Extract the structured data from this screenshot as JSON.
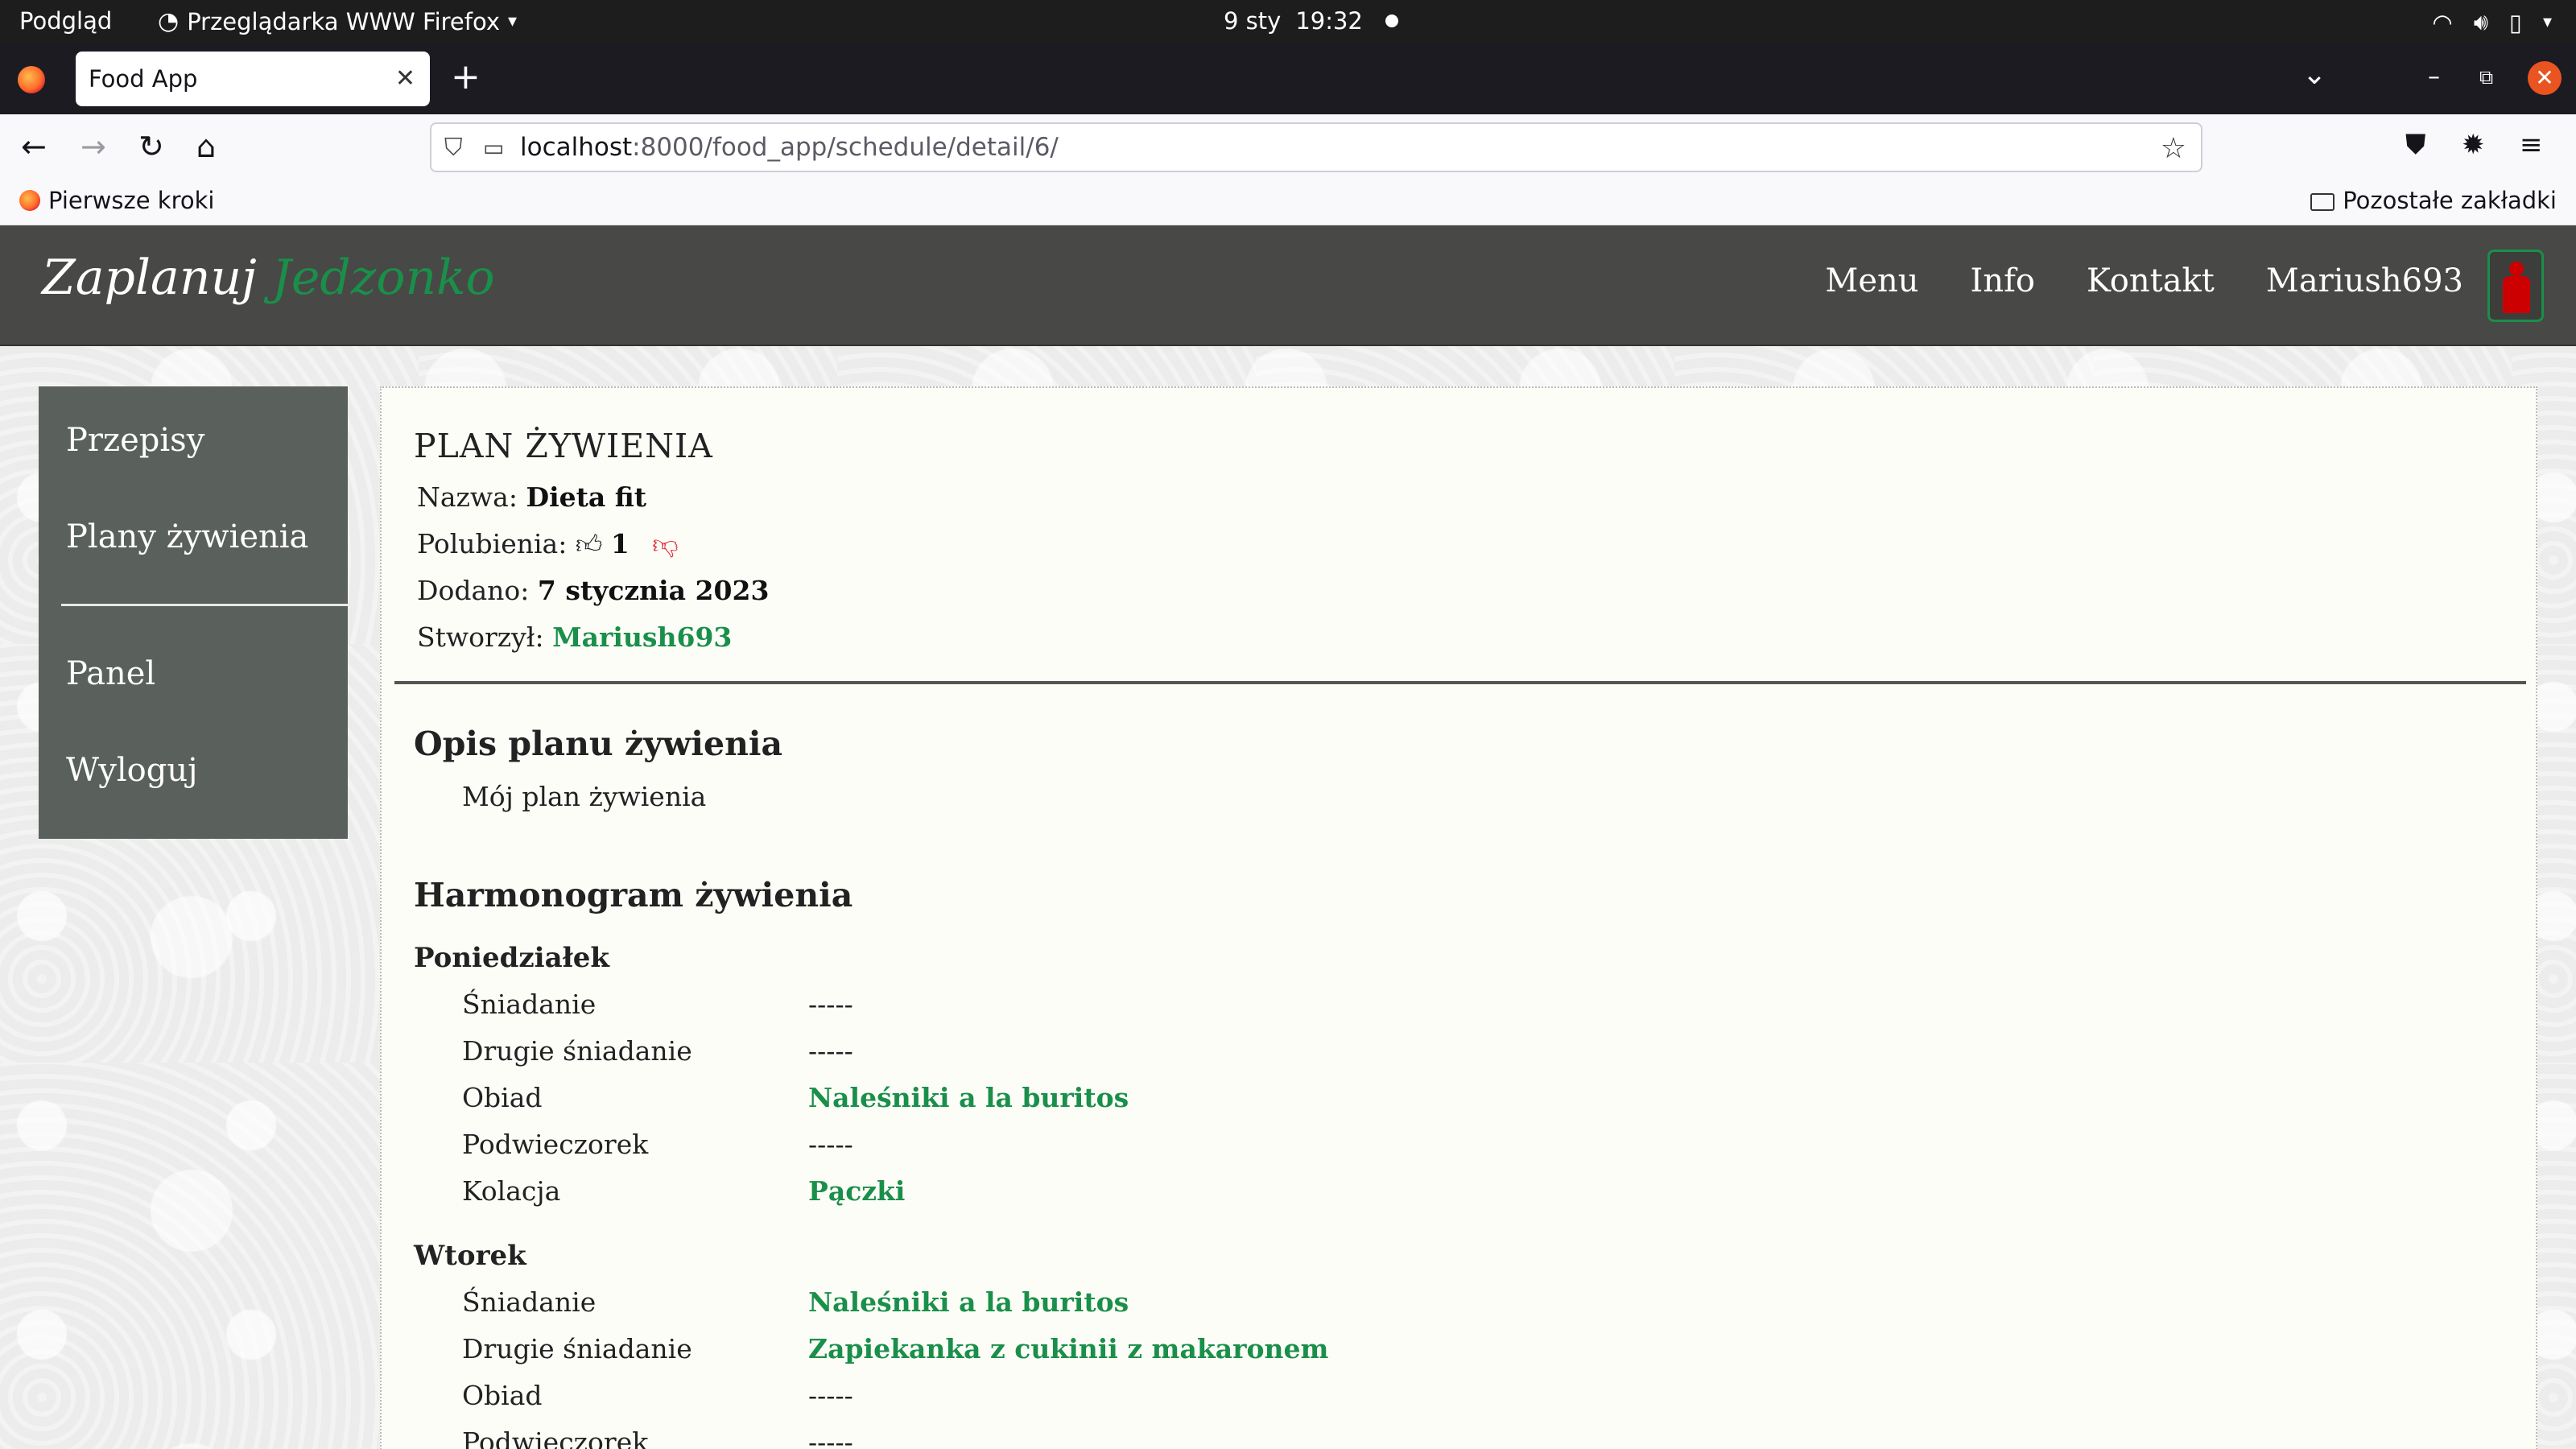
{
  "system_bar": {
    "activities": "Podgląd",
    "app_name": "Przeglądarka WWW Firefox",
    "date": "9 sty",
    "time": "19:32"
  },
  "browser": {
    "tab_title": "Food App",
    "url_host": "localhost",
    "url_path": ":8000/food_app/schedule/detail/6/",
    "bookmark_first": "Pierwsze kroki",
    "bookmark_other": "Pozostałe zakładki"
  },
  "site": {
    "logo_part1": "Zaplanuj",
    "logo_part2": "Jedzonko",
    "nav": [
      "Menu",
      "Info",
      "Kontakt",
      "Mariush693"
    ]
  },
  "sidebar": {
    "items": [
      "Przepisy",
      "Plany żywienia",
      "Panel",
      "Wyloguj"
    ]
  },
  "plan": {
    "heading": "PLAN ŻYWIENIA",
    "name_label": "Nazwa:",
    "name": "Dieta fit",
    "likes_label": "Polubienia:",
    "likes": "1",
    "added_label": "Dodano:",
    "added": "7 stycznia 2023",
    "author_label": "Stworzył:",
    "author": "Mariush693",
    "description_heading": "Opis planu żywienia",
    "description": "Mój plan żywienia",
    "schedule_heading": "Harmonogram żywienia",
    "days": [
      {
        "name": "Poniedziałek",
        "meals": [
          {
            "meal": "Śniadanie",
            "recipe": "-----"
          },
          {
            "meal": "Drugie śniadanie",
            "recipe": "-----"
          },
          {
            "meal": "Obiad",
            "recipe": "Naleśniki a la buritos"
          },
          {
            "meal": "Podwieczorek",
            "recipe": "-----"
          },
          {
            "meal": "Kolacja",
            "recipe": "Pączki"
          }
        ]
      },
      {
        "name": "Wtorek",
        "meals": [
          {
            "meal": "Śniadanie",
            "recipe": "Naleśniki a la buritos"
          },
          {
            "meal": "Drugie śniadanie",
            "recipe": "Zapiekanka z cukinii z makaronem"
          },
          {
            "meal": "Obiad",
            "recipe": "-----"
          },
          {
            "meal": "Podwieczorek",
            "recipe": "-----"
          }
        ]
      }
    ]
  },
  "colors": {
    "accent_green": "#1a8f4a",
    "header_bg": "#484846",
    "sidebar_bg": "#5a615d",
    "dislike_red": "#e0303a"
  }
}
